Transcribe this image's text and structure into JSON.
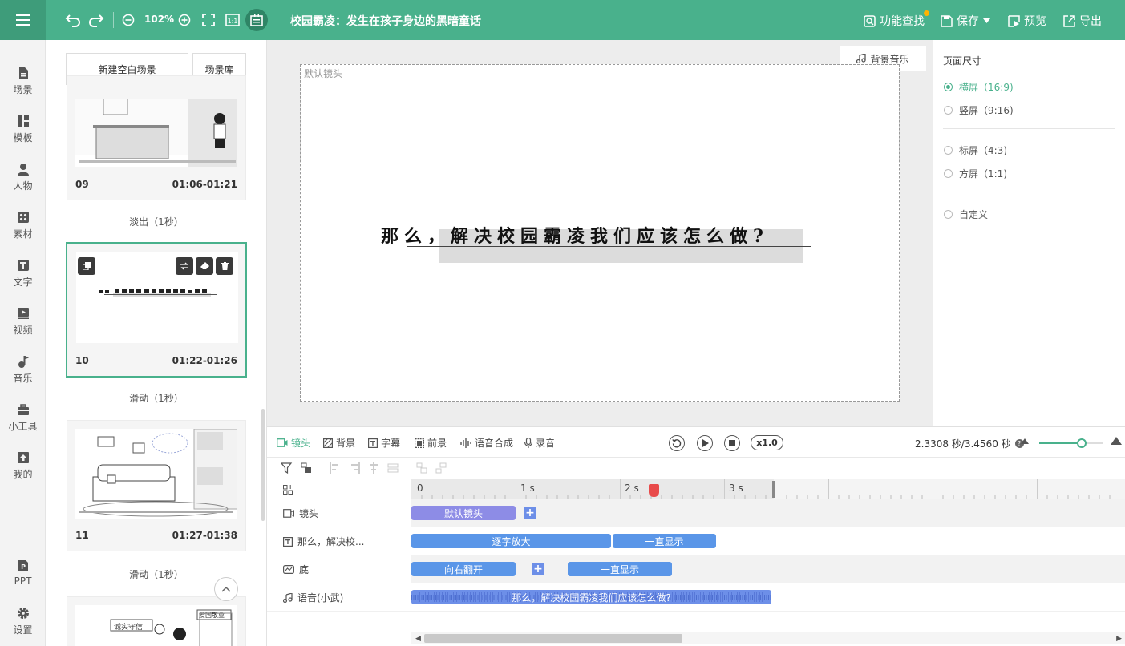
{
  "topbar": {
    "zoom": "102%",
    "title": "校园霸凌：发生在孩子身边的黑暗童话",
    "func_search": "功能查找",
    "save": "保存",
    "preview": "预览",
    "export": "导出",
    "accent": "#49b18c"
  },
  "nav": {
    "items": [
      {
        "label": "场景",
        "icon": "scene-icon"
      },
      {
        "label": "模板",
        "icon": "template-icon"
      },
      {
        "label": "人物",
        "icon": "person-icon"
      },
      {
        "label": "素材",
        "icon": "material-icon"
      },
      {
        "label": "文字",
        "icon": "text-icon"
      },
      {
        "label": "视频",
        "icon": "video-icon"
      },
      {
        "label": "音乐",
        "icon": "music-icon"
      },
      {
        "label": "小工具",
        "icon": "toolbox-icon"
      },
      {
        "label": "我的",
        "icon": "upload-icon"
      }
    ],
    "ppt": "PPT",
    "settings": "设置"
  },
  "scenes": {
    "new_blank": "新建空白场景",
    "library": "场景库",
    "cards": [
      {
        "num": "09",
        "time": "01:06-01:21",
        "transition": "淡出（1秒）"
      },
      {
        "num": "10",
        "time": "01:22-01:26",
        "transition": "滑动（1秒）"
      },
      {
        "num": "11",
        "time": "01:27-01:38",
        "transition": "滑动（1秒）"
      }
    ],
    "thumb12_text1": "诚实守信",
    "thumb12_text2": "爱国敬业"
  },
  "canvas": {
    "bg_music": "背景音乐",
    "default_camera": "默认镜头",
    "subtitle": "那么，解决校园霸凌我们应该怎么做?"
  },
  "page_size": {
    "title": "页面尺寸",
    "options": [
      {
        "label": "横屏（16:9)",
        "selected": true
      },
      {
        "label": "竖屏（9:16)",
        "selected": false
      },
      {
        "label": "标屏（4:3)",
        "selected": false
      },
      {
        "label": "方屏（1:1)",
        "selected": false
      },
      {
        "label": "自定义",
        "selected": false
      }
    ]
  },
  "timeline": {
    "tabs": [
      "镜头",
      "背景",
      "字幕",
      "前景",
      "语音合成",
      "录音"
    ],
    "speed": "x1.0",
    "time": "2.3308 秒/3.4560 秒",
    "ruler": [
      "0",
      "1 s",
      "2 s",
      "3 s"
    ],
    "tracks": [
      {
        "label": "镜头"
      },
      {
        "label": "那么，解决校..."
      },
      {
        "label": "底"
      },
      {
        "label": "语音(小武)"
      }
    ],
    "clips": {
      "camera": "默认镜头",
      "text_a": "逐字放大",
      "text_b": "一直显示",
      "bg_a": "向右翻开",
      "bg_b": "一直显示",
      "audio": "那么，解决校园霸凌我们应该怎么做?"
    },
    "playhead_seconds": 2.3308,
    "total_seconds": 3.456
  }
}
